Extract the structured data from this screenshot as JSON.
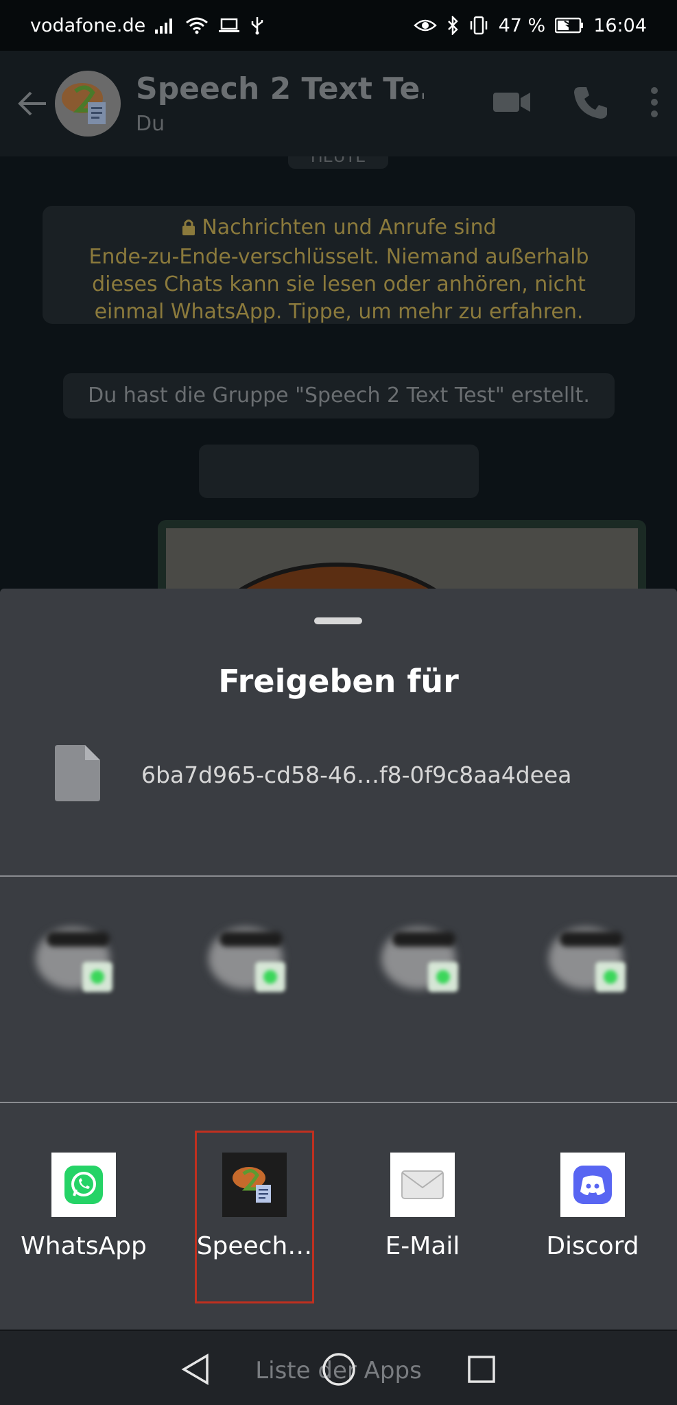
{
  "status_bar": {
    "carrier": "vodafone.de",
    "battery": "47 %",
    "time": "16:04"
  },
  "chat_header": {
    "title": "Speech 2 Text Te…",
    "subtitle": "Du"
  },
  "chat": {
    "date_chip": "HEUTE",
    "encryption_line1": "Nachrichten und Anrufe sind",
    "encryption_line2": "Ende-zu-Ende-verschlüsselt. Niemand außerhalb",
    "encryption_line3": "dieses Chats kann sie lesen oder anhören, nicht",
    "encryption_line4": "einmal WhatsApp. Tippe, um mehr zu erfahren.",
    "system_message": "Du hast die Gruppe \"Speech 2 Text Test\" erstellt."
  },
  "share_sheet": {
    "title": "Freigeben für",
    "file_name": "6ba7d965-cd58-46…f8-0f9c8aa4deea",
    "apps": [
      {
        "label": "WhatsApp",
        "icon": "whatsapp-icon",
        "color": "#25d366"
      },
      {
        "label": "Speech…",
        "icon": "speech2text-icon",
        "selected": true
      },
      {
        "label": "E-Mail",
        "icon": "email-icon"
      },
      {
        "label": "Discord",
        "icon": "discord-icon",
        "color": "#5865f2"
      }
    ],
    "selection_color": "#c0301f"
  },
  "nav_bar": {
    "hint": "Liste der Apps"
  }
}
